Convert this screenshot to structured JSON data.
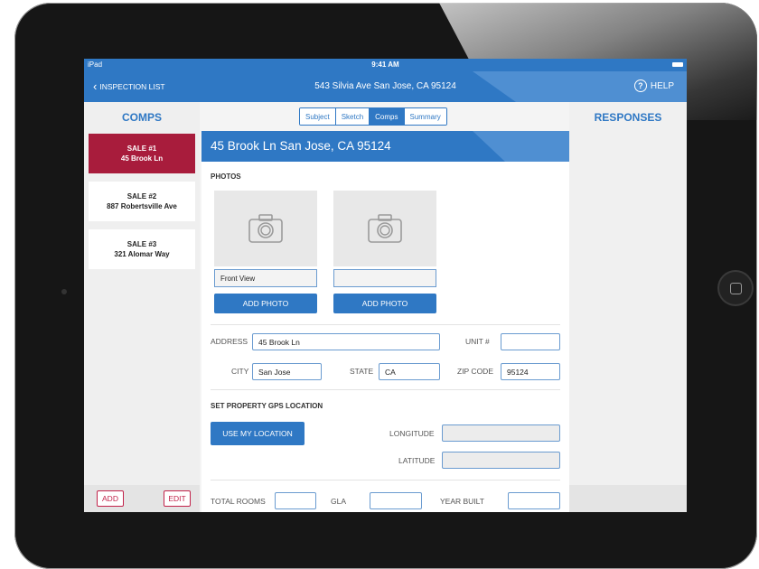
{
  "status": {
    "carrier": "iPad",
    "time": "9:41 AM"
  },
  "nav": {
    "back_label": "INSPECTION LIST",
    "title": "543 Silvia Ave San Jose, CA 95124",
    "help_label": "HELP"
  },
  "left": {
    "title": "COMPS",
    "sales": [
      {
        "line1": "SALE #1",
        "line2": "45 Brook Ln"
      },
      {
        "line1": "SALE #2",
        "line2": "887 Robertsville Ave"
      },
      {
        "line1": "SALE #3",
        "line2": "321 Alomar Way"
      }
    ],
    "add_label": "ADD",
    "edit_label": "EDIT"
  },
  "tabs": [
    "Subject",
    "Sketch",
    "Comps",
    "Summary"
  ],
  "right": {
    "title": "RESPONSES"
  },
  "form": {
    "header": "45 Brook Ln San Jose, CA 95124",
    "photos_label": "PHOTOS",
    "photo1_caption": "Front View",
    "photo2_caption": "",
    "add_photo_label": "ADD PHOTO",
    "address_label": "ADDRESS",
    "address_value": "45 Brook Ln",
    "unit_label": "UNIT #",
    "unit_value": "",
    "city_label": "CITY",
    "city_value": "San Jose",
    "state_label": "STATE",
    "state_value": "CA",
    "zip_label": "ZIP CODE",
    "zip_value": "95124",
    "gps_label": "SET PROPERTY GPS LOCATION",
    "use_location_label": "USE MY LOCATION",
    "longitude_label": "LONGITUDE",
    "latitude_label": "LATITUDE",
    "total_rooms_label": "TOTAL ROOMS",
    "gla_label": "GLA",
    "year_built_label": "YEAR BUILT"
  },
  "colors": {
    "accent": "#2f78c4",
    "active_sale": "#a81c3c"
  }
}
